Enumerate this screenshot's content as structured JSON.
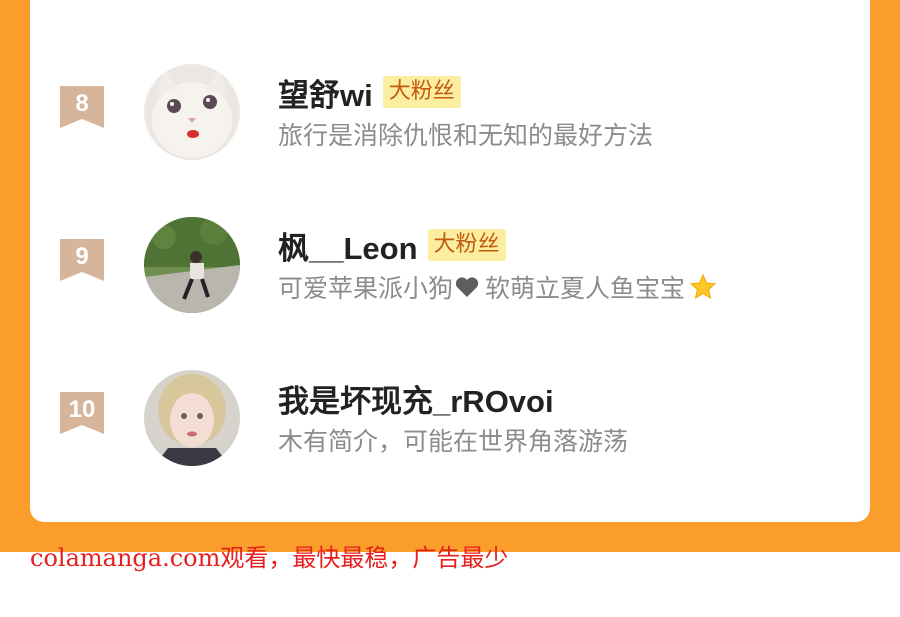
{
  "list": {
    "items": [
      {
        "rank": "8",
        "name": "望舒wi",
        "badge": "大粉丝",
        "bio": "旅行是消除仇恨和无知的最好方法"
      },
      {
        "rank": "9",
        "name": "枫__Leon",
        "badge": "大粉丝",
        "bio_part1": "可爱苹果派小狗",
        "bio_part2": "软萌立夏人鱼宝宝"
      },
      {
        "rank": "10",
        "name": "我是坏现充_rROvoi",
        "bio": "木有简介，可能在世界角落游荡"
      }
    ]
  },
  "watermark": {
    "text": "colamanga.com观看，最快最稳，广告最少"
  },
  "colors": {
    "background": "#fb9d2a",
    "badge_bg": "#fbeea0",
    "badge_text": "#c45a10",
    "rank_ribbon": "#d7b59a",
    "watermark": "#e81e1e"
  }
}
